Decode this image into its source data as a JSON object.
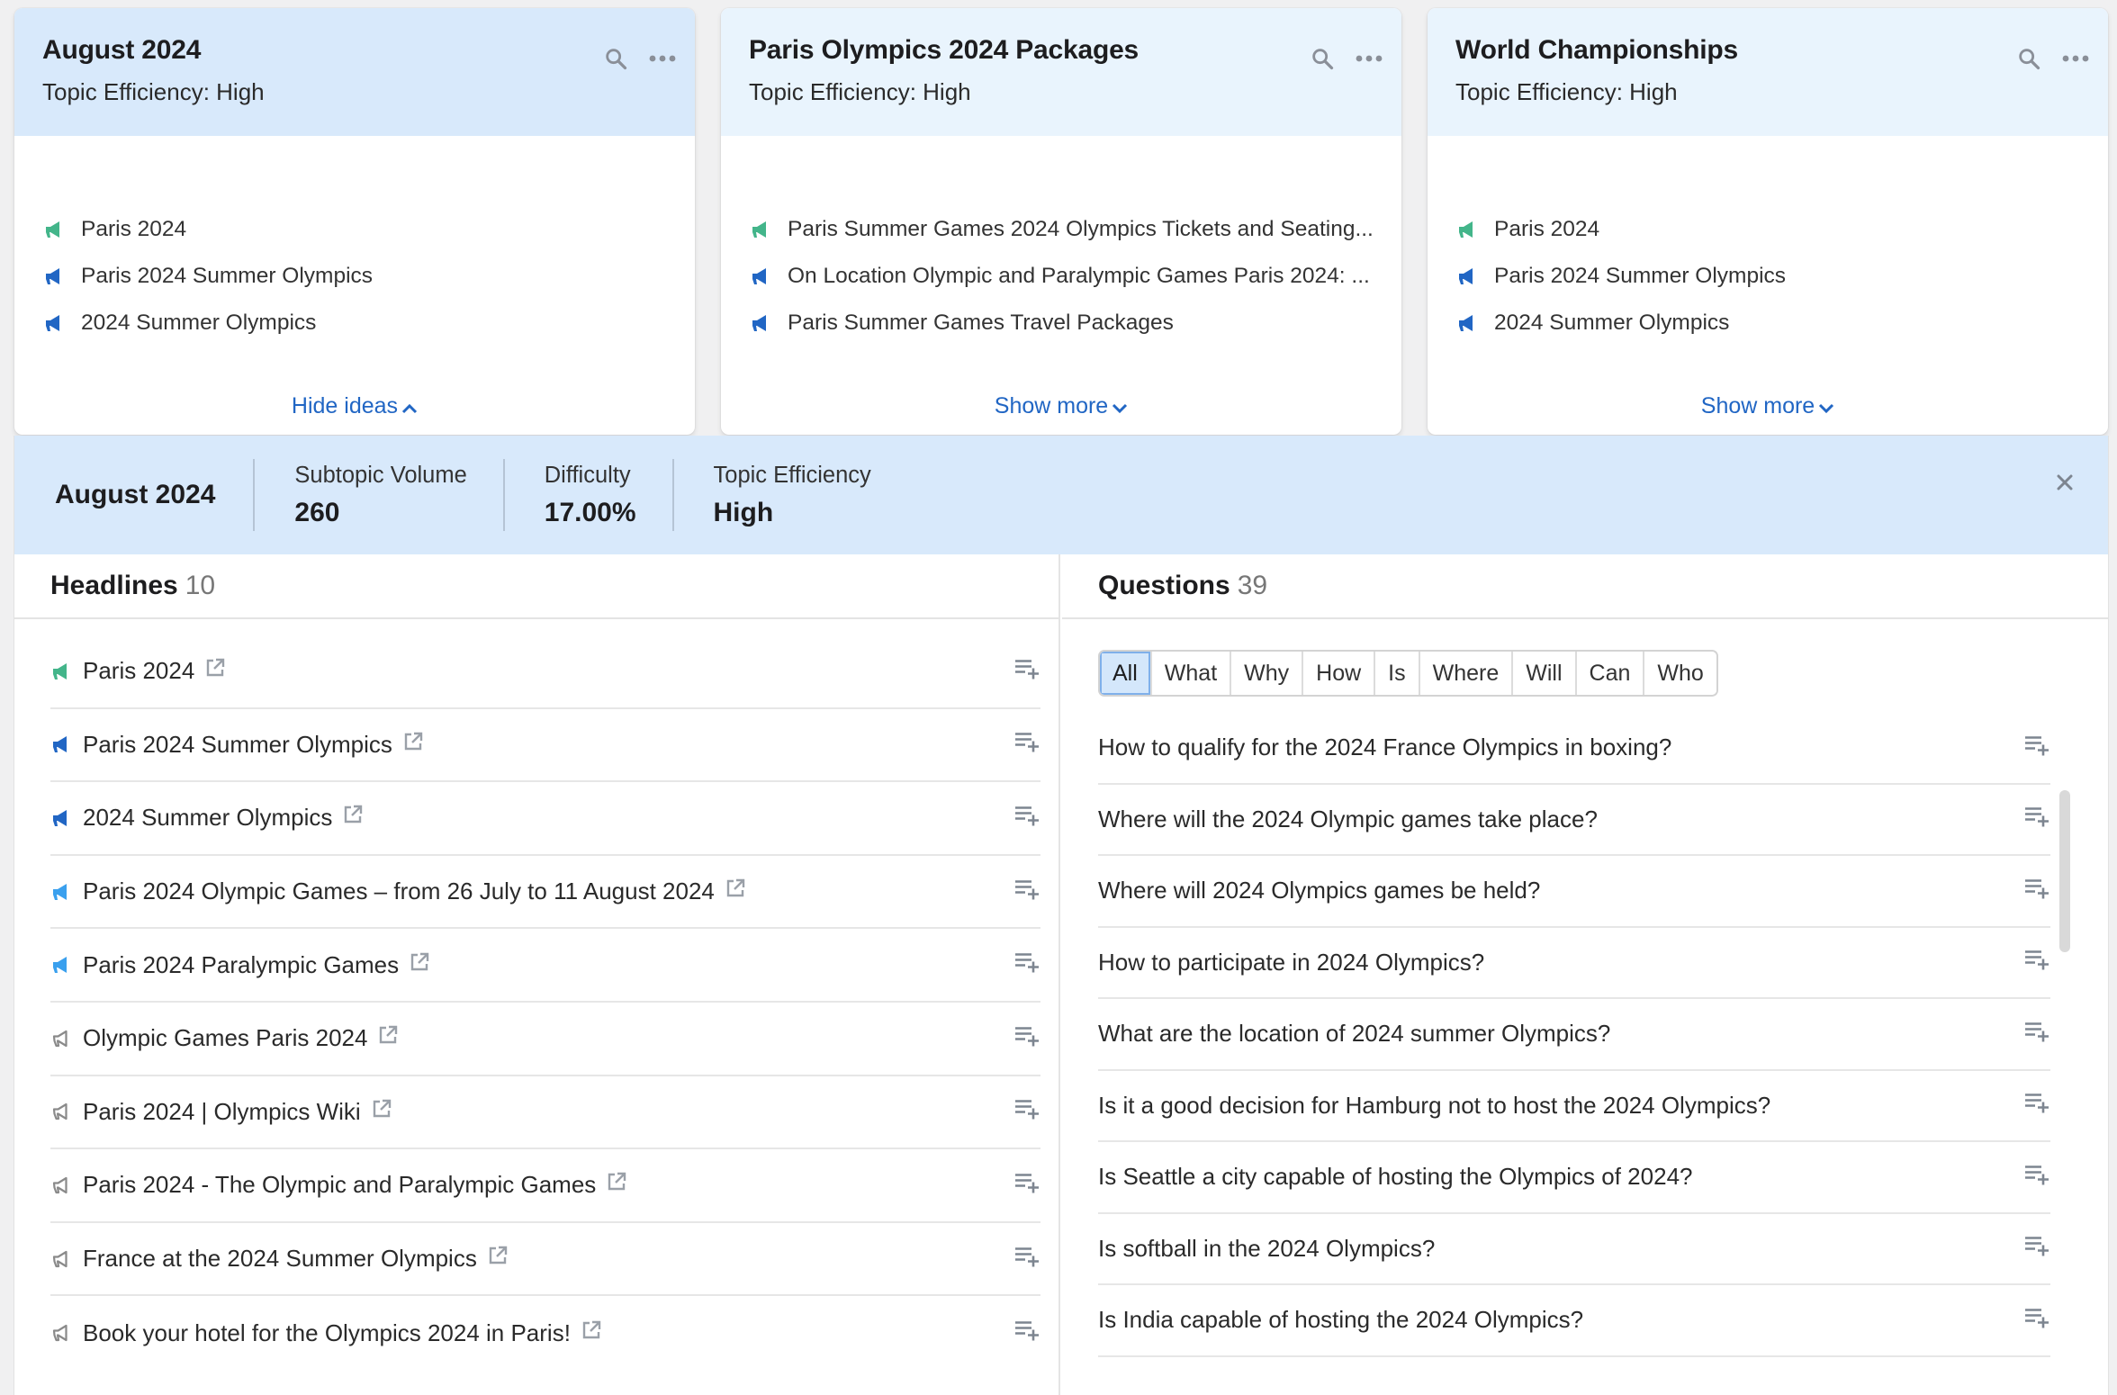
{
  "colors": {
    "selected_header": "#d8e9fb",
    "card_header": "#e9f4fd",
    "link": "#2166c4",
    "intent_green": "#43b58a",
    "intent_blue": "#2166c4",
    "intent_lightblue": "#3aa0ee",
    "intent_gray": "#8a8a8a"
  },
  "cards": [
    {
      "title": "August 2024",
      "efficiency": "Topic Efficiency: High",
      "selected": true,
      "ideas": [
        {
          "text": "Paris 2024",
          "icon": "megaphone-green-icon"
        },
        {
          "text": "Paris 2024 Summer Olympics",
          "icon": "megaphone-blue-icon"
        },
        {
          "text": "2024 Summer Olympics",
          "icon": "megaphone-blue-icon"
        }
      ],
      "footer": "Hide ideas",
      "footer_icon": "chevron-up-icon"
    },
    {
      "title": "Paris Olympics 2024 Packages",
      "efficiency": "Topic Efficiency: High",
      "selected": false,
      "ideas": [
        {
          "text": "Paris Summer Games 2024 Olympics Tickets and Seating...",
          "icon": "megaphone-green-icon"
        },
        {
          "text": "On Location Olympic and Paralympic Games Paris 2024: ...",
          "icon": "megaphone-blue-icon"
        },
        {
          "text": "Paris Summer Games Travel Packages",
          "icon": "megaphone-blue-icon"
        }
      ],
      "footer": "Show more",
      "footer_icon": "chevron-down-icon"
    },
    {
      "title": "World Championships",
      "efficiency": "Topic Efficiency: High",
      "selected": false,
      "ideas": [
        {
          "text": "Paris 2024",
          "icon": "megaphone-green-icon"
        },
        {
          "text": "Paris 2024 Summer Olympics",
          "icon": "megaphone-blue-icon"
        },
        {
          "text": "2024 Summer Olympics",
          "icon": "megaphone-blue-icon"
        }
      ],
      "footer": "Show more",
      "footer_icon": "chevron-down-icon"
    }
  ],
  "detail": {
    "title": "August 2024",
    "metrics": [
      {
        "label": "Subtopic Volume",
        "value": "260"
      },
      {
        "label": "Difficulty",
        "value": "17.00%"
      },
      {
        "label": "Topic Efficiency",
        "value": "High"
      }
    ],
    "headlines": {
      "label": "Headlines",
      "count": "10",
      "items": [
        {
          "text": "Paris 2024",
          "icon": "megaphone-green-icon"
        },
        {
          "text": "Paris 2024 Summer Olympics",
          "icon": "megaphone-blue-icon"
        },
        {
          "text": "2024 Summer Olympics",
          "icon": "megaphone-blue-icon"
        },
        {
          "text": "Paris 2024 Olympic Games – from 26 July to 11 August 2024",
          "icon": "megaphone-lightblue-icon"
        },
        {
          "text": "Paris 2024 Paralympic Games",
          "icon": "megaphone-lightblue-icon"
        },
        {
          "text": "Olympic Games Paris 2024",
          "icon": "megaphone-gray-icon"
        },
        {
          "text": "Paris 2024 | Olympics Wiki",
          "icon": "megaphone-gray-icon"
        },
        {
          "text": "Paris 2024 - The Olympic and Paralympic Games",
          "icon": "megaphone-gray-icon"
        },
        {
          "text": "France at the 2024 Summer Olympics",
          "icon": "megaphone-gray-icon"
        },
        {
          "text": "Book your hotel for the Olympics 2024 in Paris!",
          "icon": "megaphone-gray-icon"
        }
      ]
    },
    "questions": {
      "label": "Questions",
      "count": "39",
      "filters": [
        "All",
        "What",
        "Why",
        "How",
        "Is",
        "Where",
        "Will",
        "Can",
        "Who"
      ],
      "active_filter": "All",
      "items": [
        "How to qualify for the 2024 France Olympics in boxing?",
        "Where will the 2024 Olympic games take place?",
        "Where will 2024 Olympics games be held?",
        "How to participate in 2024 Olympics?",
        "What are the location of 2024 summer Olympics?",
        "Is it a good decision for Hamburg not to host the 2024 Olympics?",
        "Is Seattle a city capable of hosting the Olympics of 2024?",
        "Is softball in the 2024 Olympics?",
        "Is India capable of hosting the 2024 Olympics?"
      ]
    }
  }
}
